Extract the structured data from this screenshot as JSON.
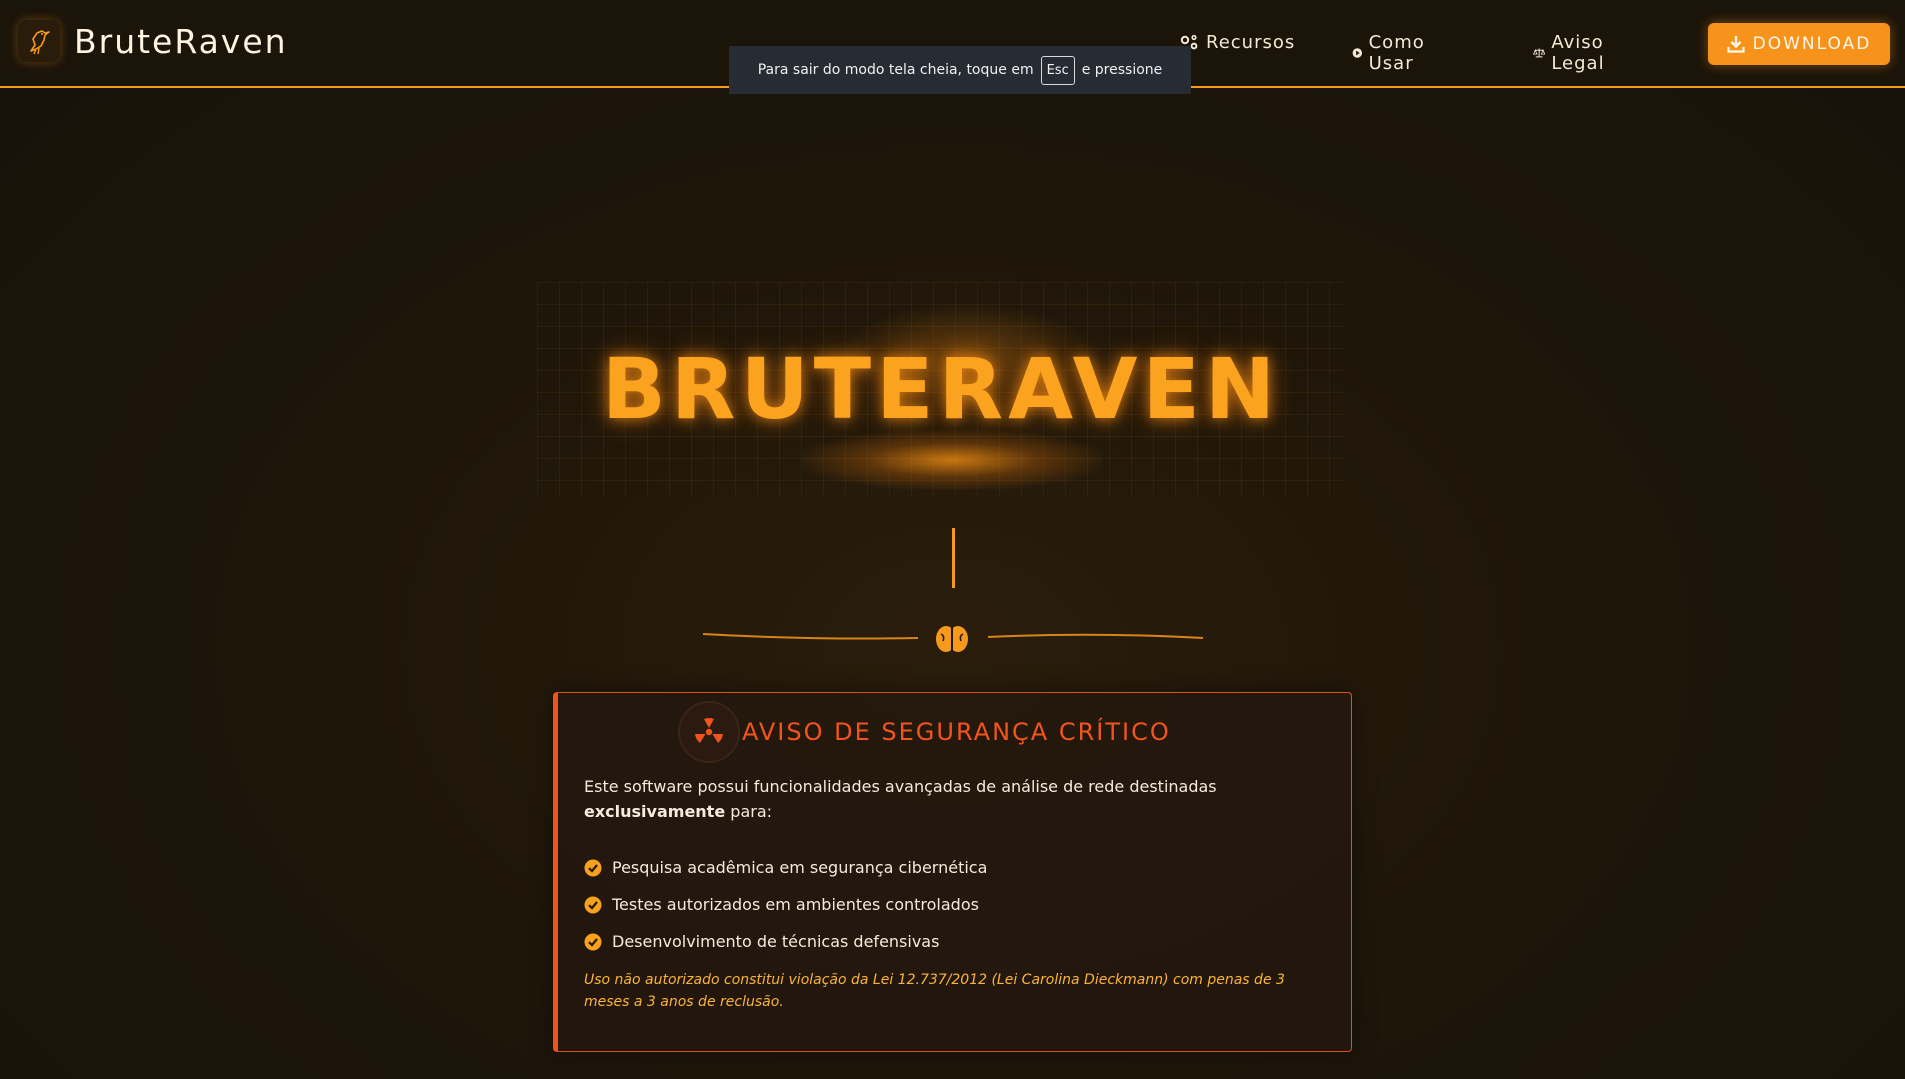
{
  "brand": {
    "name": "BruteRaven",
    "logo_icon": "raven-icon"
  },
  "nav": {
    "links": [
      {
        "label": "Recursos",
        "icon": "cogs-icon"
      },
      {
        "label": "Como Usar",
        "icon": "play-circle-icon"
      },
      {
        "label": "Aviso Legal",
        "icon": "scale-icon"
      }
    ],
    "download_label": "DOWNLOAD"
  },
  "toast": {
    "before": "Para sair do modo tela cheia, toque em",
    "key": "Esc",
    "after": "e pressione"
  },
  "hero": {
    "title": "BRUTERAVEN"
  },
  "divider": {
    "icon": "brain-icon"
  },
  "warning": {
    "title": "AVISO DE SEGURANÇA CRÍTICO",
    "icon": "radiation-icon",
    "intro_before": "Este software possui funcionalidades avançadas de análise de rede destinadas",
    "intro_bold": "exclusivamente",
    "intro_after": "para:",
    "items": [
      "Pesquisa acadêmica em segurança cibernética",
      "Testes autorizados em ambientes controlados",
      "Desenvolvimento de técnicas defensivas"
    ],
    "footnote": "Uso não autorizado constitui violação da Lei 12.737/2012 (Lei Carolina Dieckmann) com penas de 3 meses a 3 anos de reclusão."
  },
  "colors": {
    "accent": "#f7931a",
    "danger": "#f2541d",
    "background": "#1e1609"
  }
}
